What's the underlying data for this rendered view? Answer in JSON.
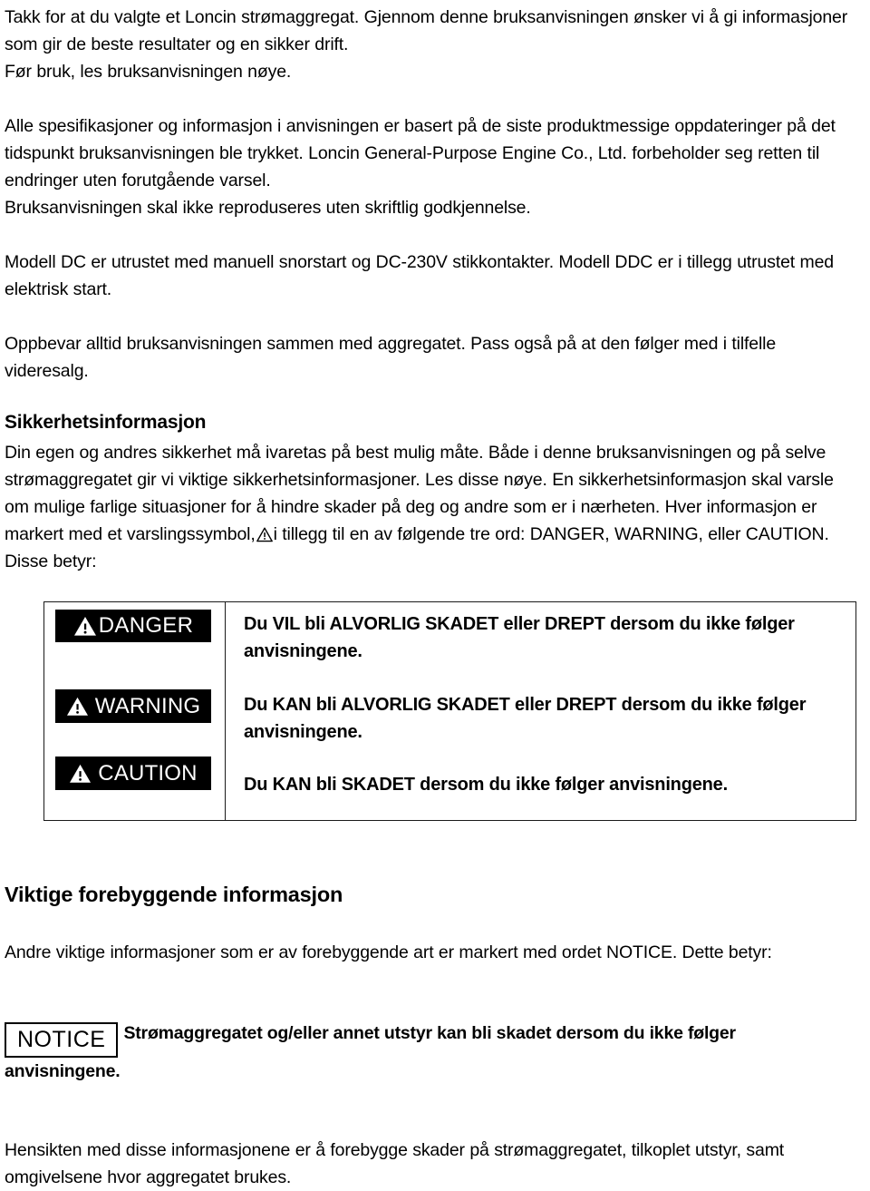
{
  "document": {
    "intro": {
      "p1": "Takk for at du valgte et Loncin strømaggregat. Gjennom denne bruksanvisningen ønsker vi å gi informasjoner som gir de beste resultater og en sikker drift.",
      "p2": "Før bruk, les bruksanvisningen nøye.",
      "p3": "Alle spesifikasjoner og informasjon i anvisningen er basert på de siste produktmessige oppdateringer på det tidspunkt bruksanvisningen ble trykket. Loncin General-Purpose Engine Co., Ltd. forbeholder seg retten til endringer uten forutgående varsel.",
      "p4": "Bruksanvisningen skal ikke reproduseres uten skriftlig godkjennelse.",
      "p5": "Modell DC er utrustet med manuell snorstart og DC-230V stikkontakter. Modell DDC er i tillegg utrustet med elektrisk start.",
      "p6": "Oppbevar alltid bruksanvisningen sammen med aggregatet. Pass også på at den følger med i tilfelle videresalg."
    },
    "safety": {
      "heading": "Sikkerhetsinformasjon",
      "body_part1": "Din egen og andres sikkerhet må ivaretas på best mulig måte. Både i denne bruksanvisningen og på selve strømaggregatet gir vi viktige sikkerhetsinformasjoner. Les disse nøye. En sikkerhetsinformasjon skal varsle om mulige farlige situasjoner for å hindre skader på deg og andre som er i nærheten. Hver informasjon er markert med et varslingssymbol,",
      "warning_symbol_icon": "warning-triangle-icon",
      "body_part2": "i tillegg til en av følgende tre ord: DANGER, WARNING, eller CAUTION. Disse betyr:"
    },
    "warning_table": {
      "rows": [
        {
          "badge_label": "DANGER",
          "badge_icon": "warning-triangle-icon",
          "description": "Du VIL bli ALVORLIG SKADET eller DREPT dersom du ikke følger anvisningene."
        },
        {
          "badge_label": "WARNING",
          "badge_icon": "warning-triangle-icon",
          "description": "Du KAN bli ALVORLIG SKADET eller DREPT dersom du ikke følger anvisningene."
        },
        {
          "badge_label": "CAUTION",
          "badge_icon": "warning-triangle-icon",
          "description": "Du KAN bli SKADET dersom du ikke følger anvisningene."
        }
      ],
      "badge_background_color": "#000000",
      "badge_text_color": "#ffffff",
      "border_color": "#1a1a1a"
    },
    "prevention": {
      "heading": "Viktige forebyggende informasjon",
      "intro": "Andre viktige informasjoner som er av forebyggende art er markert med ordet NOTICE. Dette betyr:",
      "notice_label": "NOTICE",
      "notice_text": "Strømaggregatet og/eller annet utstyr kan bli skadet dersom du ikke følger anvisningene.",
      "closing": "Hensikten med disse informasjonene er å forebygge skader på strømaggregatet, tilkoplet utstyr, samt omgivelsene hvor aggregatet brukes."
    }
  }
}
